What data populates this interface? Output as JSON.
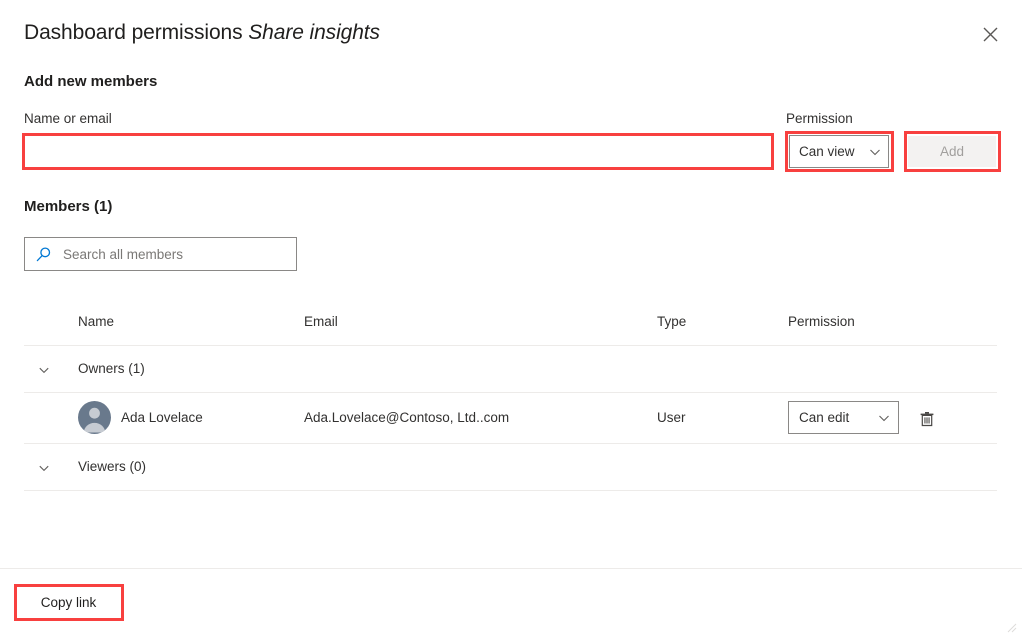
{
  "dialog": {
    "title_main": "Dashboard permissions",
    "title_sub": "Share insights",
    "close_icon": "close-icon"
  },
  "add_members": {
    "heading": "Add new members",
    "name_label": "Name or email",
    "name_value": "",
    "name_placeholder": "",
    "permission_label": "Permission",
    "permission_value": "Can view",
    "permission_options": [
      "Can view",
      "Can edit"
    ],
    "add_button": "Add",
    "add_button_disabled": true
  },
  "members": {
    "heading": "Members (1)",
    "search_placeholder": "Search all members",
    "search_value": "",
    "search_icon": "search-icon",
    "columns": {
      "name": "Name",
      "email": "Email",
      "type": "Type",
      "permission": "Permission"
    },
    "groups": [
      {
        "label": "Owners (1)",
        "chevron_icon": "chevron-down-icon",
        "expanded": true
      },
      {
        "label": "Viewers (0)",
        "chevron_icon": "chevron-down-icon",
        "expanded": true
      }
    ],
    "rows": [
      {
        "name": "Ada Lovelace",
        "email": "Ada.Lovelace@Contoso, Ltd..com",
        "type": "User",
        "permission": "Can edit",
        "permission_options": [
          "Can view",
          "Can edit"
        ],
        "avatar_icon": "person-avatar-icon",
        "delete_icon": "trash-icon"
      }
    ]
  },
  "footer": {
    "copy_link": "Copy link"
  },
  "annotations": {
    "color": "#f8403f",
    "targets": [
      "name-or-email-input",
      "permission-dropdown",
      "add-button",
      "copy-link-button"
    ]
  }
}
